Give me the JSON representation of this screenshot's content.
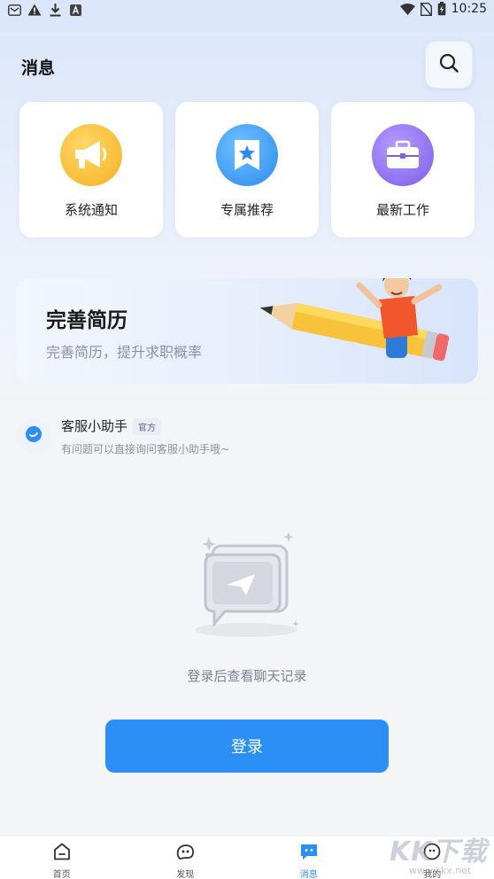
{
  "status_bar": {
    "time": "10:25",
    "left_icons": [
      "mail-icon",
      "warning-icon",
      "download-icon",
      "app-a-icon"
    ],
    "right_icons": [
      "wifi-icon",
      "no-sim-icon",
      "battery-charging-icon"
    ]
  },
  "header": {
    "title": "消息",
    "search_icon": "search-icon"
  },
  "quick_cards": [
    {
      "label": "系统通知",
      "icon": "megaphone-icon",
      "color": "#f7b733"
    },
    {
      "label": "专属推荐",
      "icon": "bookmark-star-icon",
      "color": "#3a9bf0"
    },
    {
      "label": "最新工作",
      "icon": "briefcase-icon",
      "color": "#8e6ff0"
    }
  ],
  "banner": {
    "title": "完善简历",
    "subtitle": "完善简历，提升求职概率"
  },
  "assistant": {
    "name": "客服小助手",
    "badge": "官方",
    "description": "有问题可以直接询问客服小助手哦~"
  },
  "empty_state": {
    "text": "登录后查看聊天记录"
  },
  "login_button": {
    "label": "登录",
    "color": "#2b8ff5"
  },
  "tabs": [
    {
      "label": "首页",
      "icon": "home-icon",
      "active": false
    },
    {
      "label": "发现",
      "icon": "discover-icon",
      "active": false
    },
    {
      "label": "消息",
      "icon": "message-icon",
      "active": true
    },
    {
      "label": "我的",
      "icon": "profile-icon",
      "active": false
    }
  ],
  "watermark": {
    "text": "KK下载",
    "sub": "www.kkx.net"
  }
}
